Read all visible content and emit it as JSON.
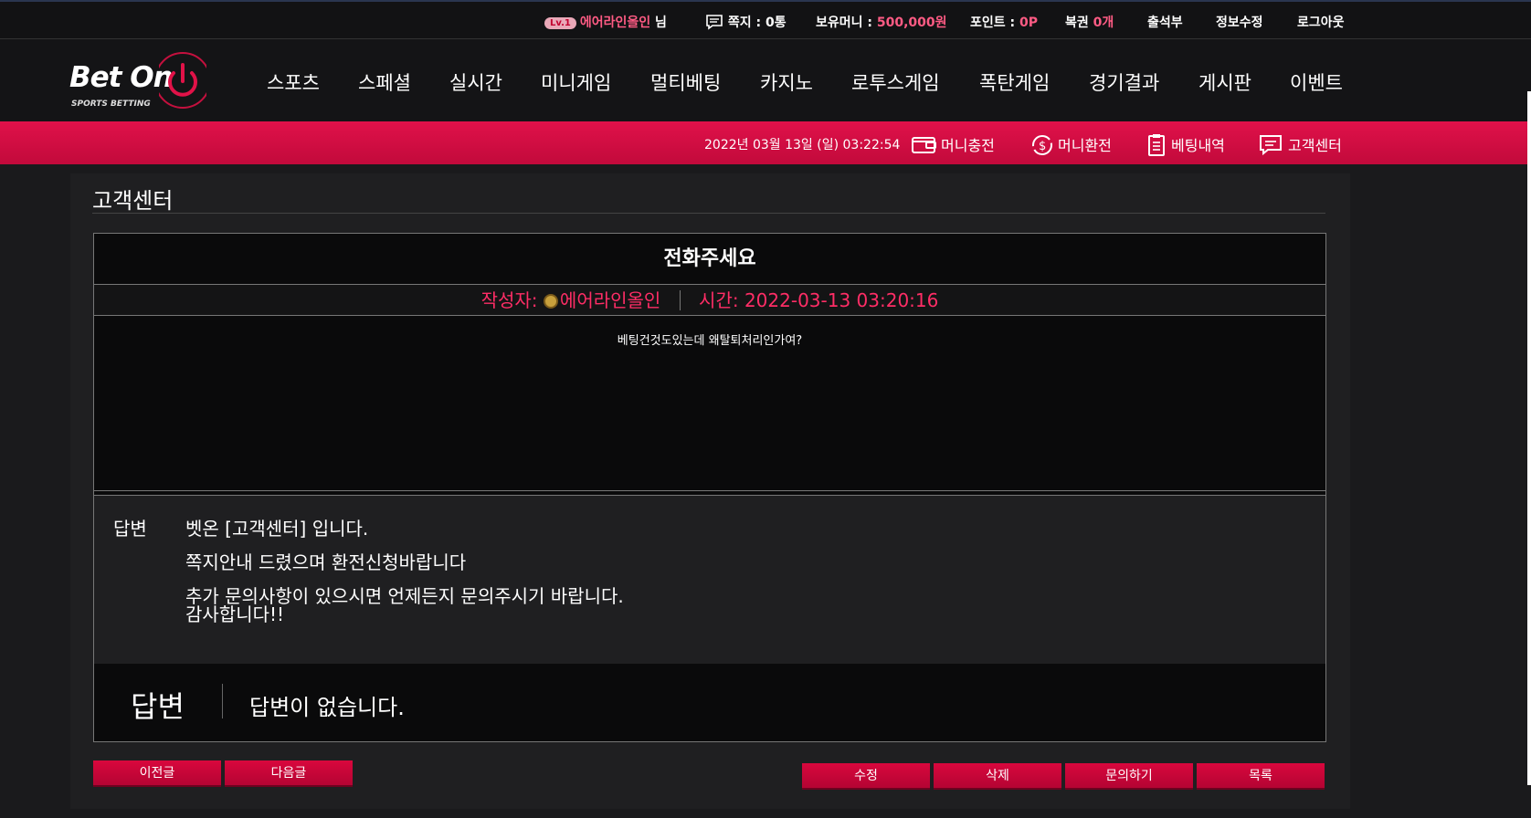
{
  "topbar": {
    "level_badge": "Lv.1",
    "user_name": "에어라인올인",
    "user_suffix": "님",
    "messages_label": "쪽지 :",
    "messages_value": "0통",
    "money_label": "보유머니 :",
    "money_value": "500,000원",
    "points_label": "포인트 :",
    "points_value": "0P",
    "lottery_label": "복권",
    "lottery_value": "0개",
    "attendance": "출석부",
    "edit_info": "정보수정",
    "logout": "로그아웃"
  },
  "logo": {
    "main": "Bet On",
    "sub": "SPORTS BETTING"
  },
  "nav": [
    "스포츠",
    "스페셜",
    "실시간",
    "미니게임",
    "멀티베팅",
    "카지노",
    "로투스게임",
    "폭탄게임",
    "경기결과",
    "게시판",
    "이벤트"
  ],
  "subbar": {
    "datetime": "2022년 03월 13일 (일) 03:22:54",
    "deposit": "머니충전",
    "withdraw": "머니환전",
    "bet_history": "베팅내역",
    "support": "고객센터"
  },
  "page": {
    "title": "고객센터",
    "post_title": "전화주세요",
    "author_label": "작성자:",
    "author_name": "에어라인올인",
    "time_label": "시간:",
    "time_value": "2022-03-13 03:20:16",
    "body": "베팅건것도있는데 왜탈퇴처리인가여?",
    "answer_label": "답변",
    "answer_lines": [
      "벳온 [고객센터] 입니다.",
      "쪽지안내 드렸으며 환전신청바랍니다",
      "추가 문의사항이 있으시면 언제든지 문의주시기 바랍니다.",
      "감사합니다!!"
    ],
    "no_answer_label": "답변",
    "no_answer_text": "답변이 없습니다."
  },
  "buttons": {
    "prev": "이전글",
    "next": "다음글",
    "edit": "수정",
    "delete": "삭제",
    "inquire": "문의하기",
    "list": "목록"
  },
  "colors": {
    "accent": "#d9073d",
    "highlight": "#ff2d66"
  }
}
